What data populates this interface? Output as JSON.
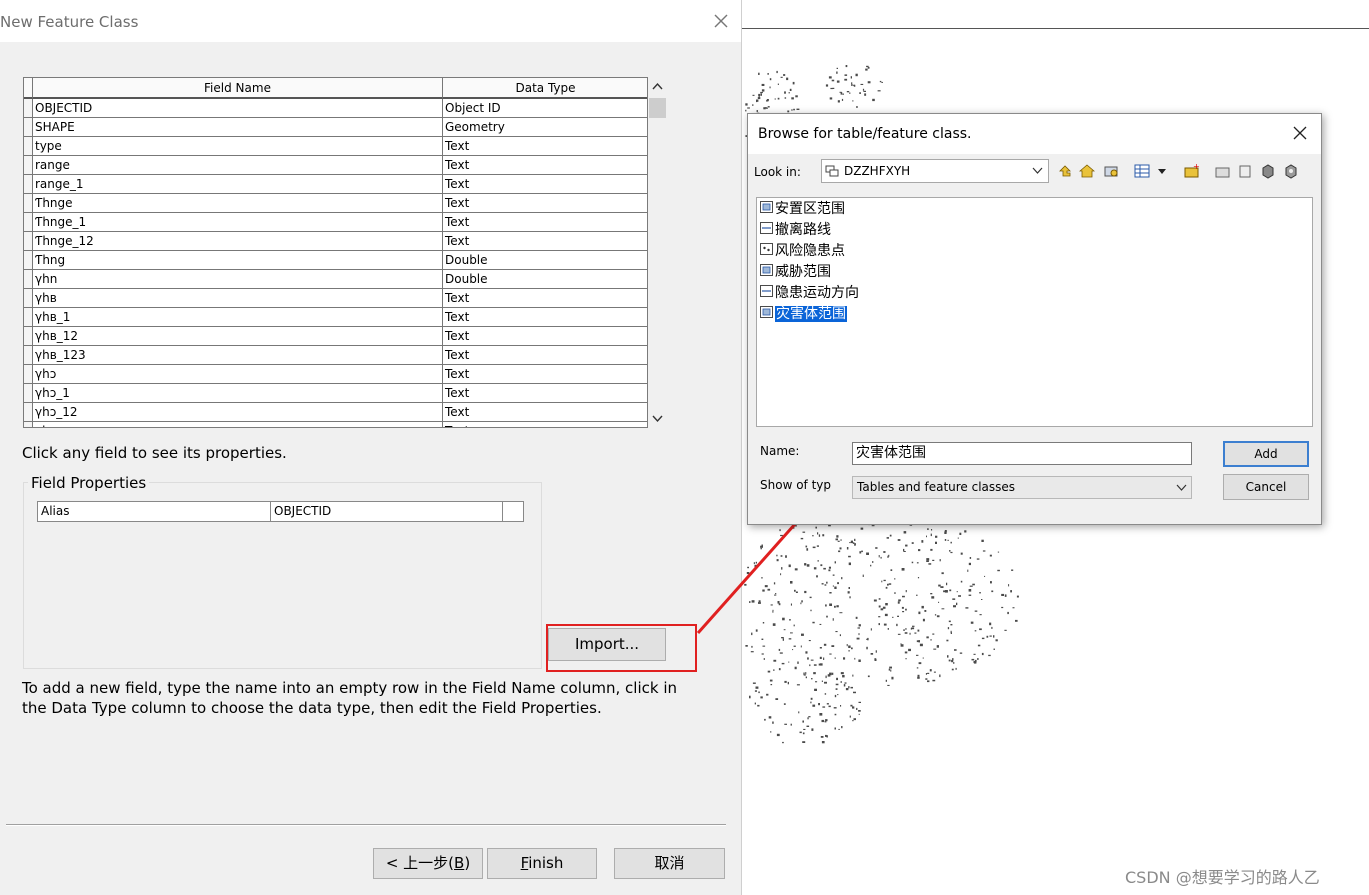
{
  "main_dialog": {
    "title": "New Feature Class",
    "grid": {
      "columns": [
        "Field Name",
        "Data Type"
      ],
      "rows": [
        {
          "name": "OBJECTID",
          "type": "Object ID"
        },
        {
          "name": "SHAPE",
          "type": "Geometry"
        },
        {
          "name": "type",
          "type": "Text"
        },
        {
          "name": "range",
          "type": "Text"
        },
        {
          "name": "range_1",
          "type": "Text"
        },
        {
          "name": "Ƭhnge",
          "type": "Text"
        },
        {
          "name": "Ƭhnge_1",
          "type": "Text"
        },
        {
          "name": "Ƭhnge_12",
          "type": "Text"
        },
        {
          "name": "Ƭhng",
          "type": "Double"
        },
        {
          "name": "γhn",
          "type": "Double"
        },
        {
          "name": "γhв",
          "type": "Text"
        },
        {
          "name": "γhв_1",
          "type": "Text"
        },
        {
          "name": "γhв_12",
          "type": "Text"
        },
        {
          "name": "γhв_123",
          "type": "Text"
        },
        {
          "name": "γhɔ",
          "type": "Text"
        },
        {
          "name": "γhɔ_1",
          "type": "Text"
        },
        {
          "name": "γhɔ_12",
          "type": "Text"
        },
        {
          "name": "γh",
          "type": "Text"
        }
      ]
    },
    "hint_click": "Click any field to see its properties.",
    "field_properties": {
      "legend": "Field Properties",
      "alias_label": "Alias",
      "alias_value": "OBJECTID"
    },
    "import_button": "Import...",
    "instructions_line1": "To add a new field, type the name into an empty row in the Field Name column, click in",
    "instructions_line2": "the Data Type column to choose the data type, then edit the Field Properties.",
    "back_button_prefix": "< 上一步(",
    "back_button_key": "B",
    "back_button_suffix": ")",
    "finish_key": "F",
    "finish_rest": "inish",
    "cancel_button": "取消"
  },
  "browse_dialog": {
    "title": "Browse for table/feature class.",
    "look_in_label": "Look in:",
    "look_in_value": "DZZHFXYH",
    "items": [
      {
        "label": "安置区范围",
        "icon": "polygon-class-icon",
        "selected": false
      },
      {
        "label": "撤离路线",
        "icon": "line-class-icon",
        "selected": false
      },
      {
        "label": "风险隐患点",
        "icon": "point-class-icon",
        "selected": false
      },
      {
        "label": "威胁范围",
        "icon": "polygon-class-icon",
        "selected": false
      },
      {
        "label": "隐患运动方向",
        "icon": "line-class-icon",
        "selected": false
      },
      {
        "label": "灾害体范围",
        "icon": "polygon-class-icon",
        "selected": true
      }
    ],
    "name_label": "Name:",
    "name_value": "灾害体范围",
    "show_type_label": "Show of typ",
    "show_type_value": "Tables and feature classes",
    "add_button": "Add",
    "cancel_button": "Cancel"
  },
  "watermark": "CSDN @想要学习的路人乙",
  "colors": {
    "highlight": "#e02020",
    "selection": "#0a64d8",
    "dialog_bg": "#f0f0f0"
  }
}
